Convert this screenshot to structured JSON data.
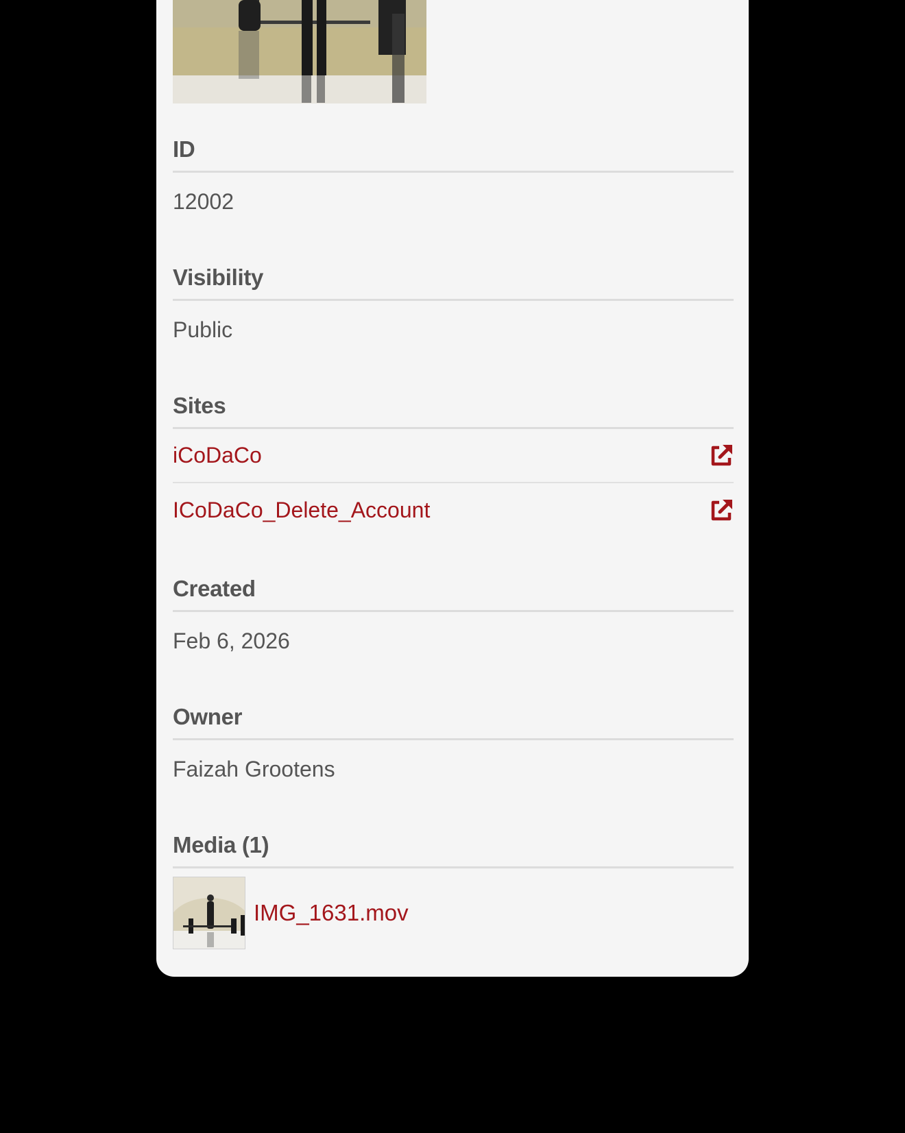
{
  "fields": {
    "id": {
      "label": "ID",
      "value": "12002"
    },
    "visibility": {
      "label": "Visibility",
      "value": "Public"
    },
    "sites": {
      "label": "Sites",
      "items": [
        {
          "name": "iCoDaCo",
          "icon": "external-link-icon"
        },
        {
          "name": "ICoDaCo_Delete_Account",
          "icon": "external-link-icon"
        }
      ]
    },
    "created": {
      "label": "Created",
      "value": "Feb 6, 2026"
    },
    "owner": {
      "label": "Owner",
      "value": "Faizah Grootens"
    },
    "media": {
      "label": "Media (1)",
      "items": [
        {
          "filename": "IMG_1631.mov"
        }
      ]
    }
  },
  "colors": {
    "background": "#000000",
    "panel": "#f5f5f5",
    "label_text": "#555555",
    "link": "#a3161b",
    "rule": "#dcdcdc"
  }
}
